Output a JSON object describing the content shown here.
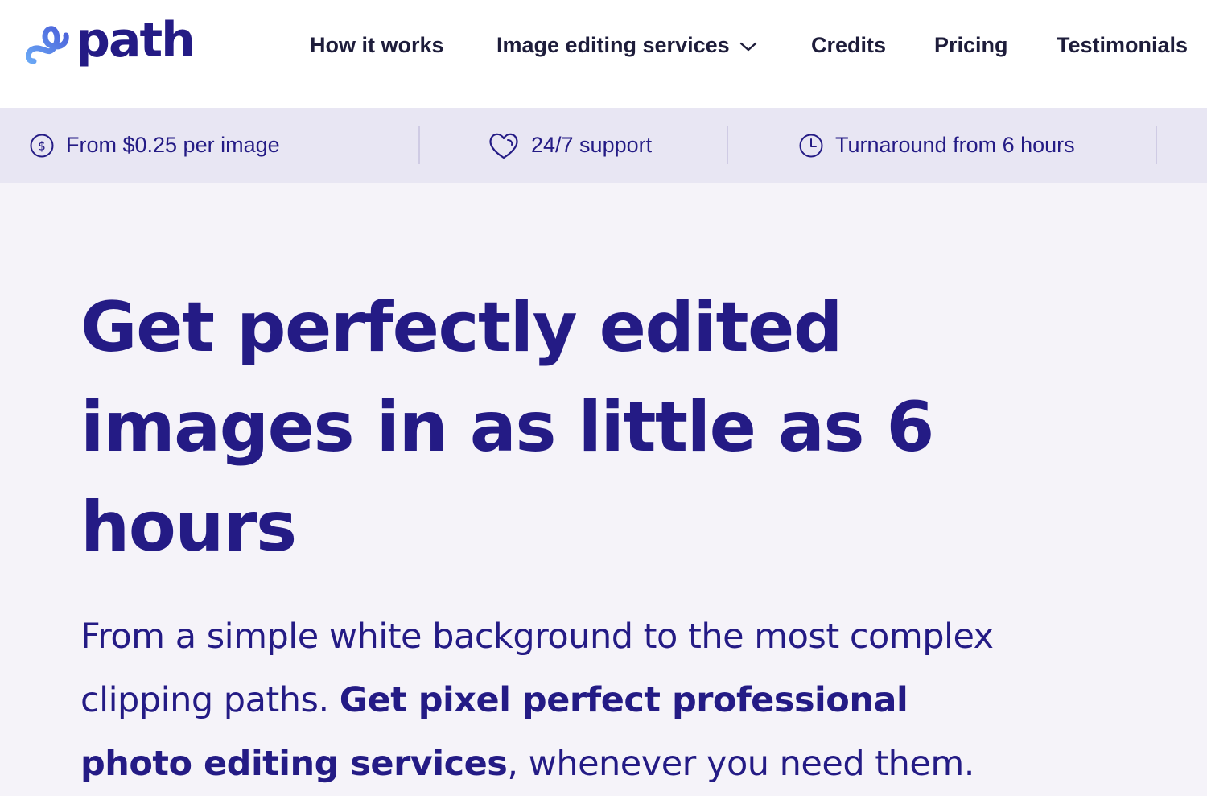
{
  "brand": {
    "name": "path",
    "logo_icon": "infinity-loop-icon",
    "colors": {
      "primary": "#241b85",
      "accent_light": "#6aa8f5",
      "accent_mid": "#4a6fd9"
    }
  },
  "nav": {
    "items": [
      {
        "label": "How it works"
      },
      {
        "label": "Image editing services",
        "icon": "chevron-down-icon"
      },
      {
        "label": "Credits"
      },
      {
        "label": "Pricing"
      },
      {
        "label": "Testimonials"
      }
    ]
  },
  "features": [
    {
      "icon": "dollar-coin-icon",
      "label": "From $0.25 per image"
    },
    {
      "icon": "heart-icon",
      "label": "24/7 support"
    },
    {
      "icon": "clock-icon",
      "label": "Turnaround from 6 hours"
    }
  ],
  "hero": {
    "title": "Get perfectly edited images in as little as 6 hours",
    "subtitle_lead": "From a simple white background to the most complex clipping paths. ",
    "subtitle_bold": "Get pixel perfect professional photo editing services",
    "subtitle_tail": ", whenever you need them."
  }
}
